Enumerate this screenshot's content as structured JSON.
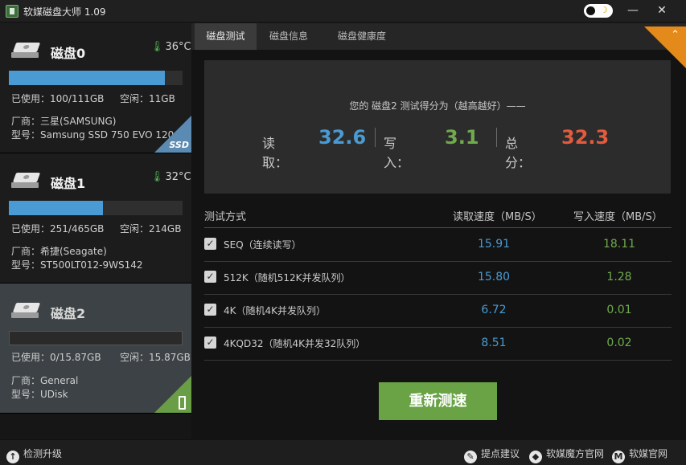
{
  "window": {
    "title": "软媒磁盘大师 1.09",
    "minimize_label": "—",
    "close_label": "✕",
    "theme_moon": "☽"
  },
  "disks": [
    {
      "name": "磁盘0",
      "temp": "36°C",
      "usage_fraction": 0.9,
      "used": "已使用：100/111GB",
      "free": "空闲：11GB",
      "vendor": "厂商：三星(SAMSUNG)",
      "model": "型号：Samsung SSD 750 EVO 120GB",
      "badge": "SSD"
    },
    {
      "name": "磁盘1",
      "temp": "32°C",
      "usage_fraction": 0.54,
      "used": "已使用：251/465GB",
      "free": "空闲：214GB",
      "vendor": "厂商：希捷(Seagate)",
      "model": "型号：ST500LT012-9WS142"
    },
    {
      "name": "磁盘2",
      "usage_fraction": 0.0,
      "used": "已使用：0/15.87GB",
      "free": "空闲：15.87GB",
      "vendor": "厂商：General",
      "model": "型号：UDisk",
      "badge_icon": "usb-icon"
    }
  ],
  "tabs": [
    "磁盘测试",
    "磁盘信息",
    "磁盘健康度"
  ],
  "score": {
    "subtitle": "您的 磁盘2 测试得分为（越高越好）——",
    "read_label": "读取：",
    "read_value": "32.6",
    "write_label": "写入：",
    "write_value": "3.1",
    "total_label": "总分：",
    "total_value": "32.3",
    "read_color": "#4a9ad3",
    "write_color": "#6fab4c",
    "total_color": "#e35b3c"
  },
  "table": {
    "col_method": "测试方式",
    "col_read": "读取速度（MB/S）",
    "col_write": "写入速度（MB/S）",
    "check_mark": "✓",
    "rows": [
      {
        "label": "SEQ（连续读写）",
        "read": "15.91",
        "write": "18.11"
      },
      {
        "label": "512K（随机512K并发队列）",
        "read": "15.80",
        "write": "1.28"
      },
      {
        "label": "4K（随机4K并发队列）",
        "read": "6.72",
        "write": "0.01"
      },
      {
        "label": "4KQD32（随机4K并发32队列）",
        "read": "8.51",
        "write": "0.02"
      }
    ]
  },
  "retest_label": "重新测速",
  "bottom": {
    "check_update": "检测升级",
    "feedback": "提点建议",
    "mofang_site": "软媒魔方官网",
    "ruanmei_site": "软媒官网"
  }
}
